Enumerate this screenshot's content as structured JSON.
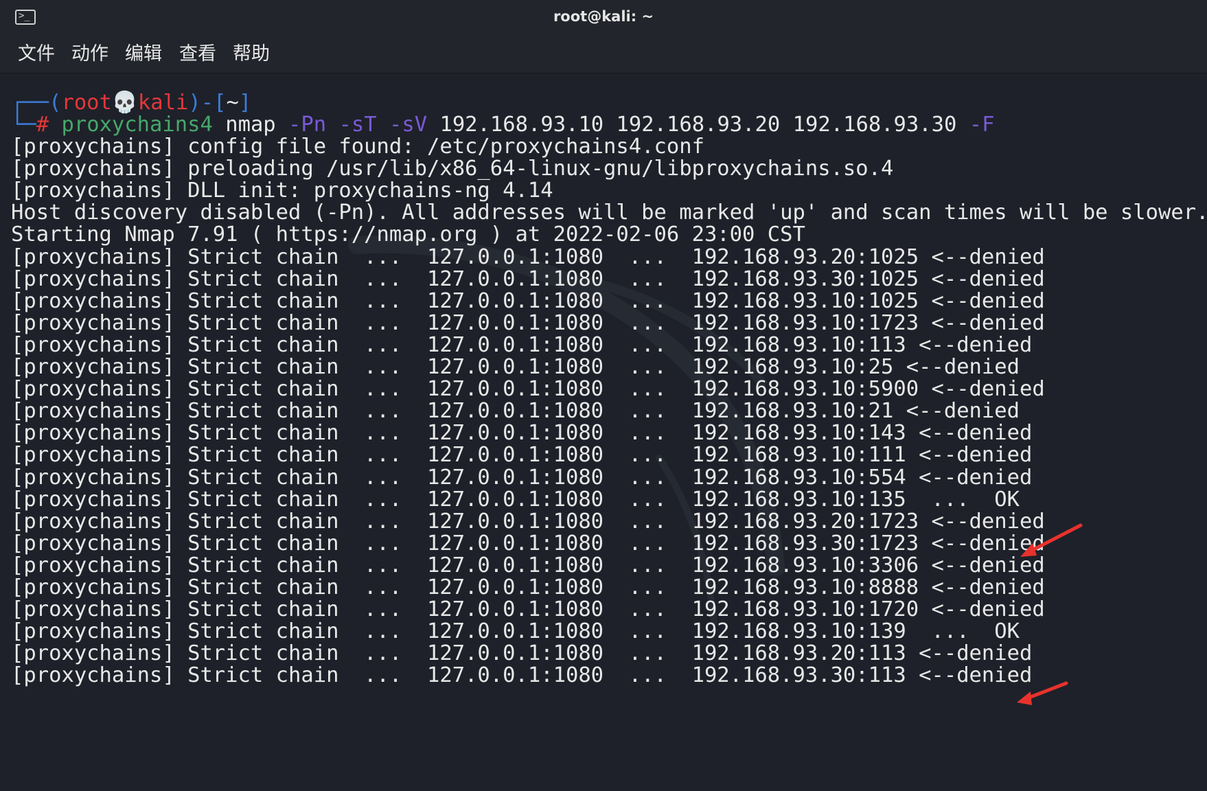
{
  "window": {
    "title": "root@kali: ~",
    "icon": "terminal-icon"
  },
  "menu": [
    "文件",
    "动作",
    "编辑",
    "查看",
    "帮助"
  ],
  "prompt": {
    "box_top": "┌──(",
    "user": "root",
    "skull": "💀",
    "host": "kali",
    "path_open": ")-[",
    "path": "~",
    "path_close": "]",
    "box_bottom": "└─",
    "hash": "#",
    "cmd": "proxychains4",
    "prog": "nmap",
    "args": [
      {
        "text": "-Pn",
        "kind": "flag"
      },
      {
        "text": "-sT",
        "kind": "flag"
      },
      {
        "text": "-sV",
        "kind": "flag"
      },
      {
        "text": "192.168.93.10",
        "kind": "arg"
      },
      {
        "text": "192.168.93.20",
        "kind": "arg"
      },
      {
        "text": "192.168.93.30",
        "kind": "arg"
      },
      {
        "text": "-F",
        "kind": "flag"
      }
    ]
  },
  "output": [
    "[proxychains] config file found: /etc/proxychains4.conf",
    "[proxychains] preloading /usr/lib/x86_64-linux-gnu/libproxychains.so.4",
    "[proxychains] DLL init: proxychains-ng 4.14",
    "Host discovery disabled (-Pn). All addresses will be marked 'up' and scan times will be slower.",
    "Starting Nmap 7.91 ( https://nmap.org ) at 2022-02-06 23:00 CST",
    "[proxychains] Strict chain  ...  127.0.0.1:1080  ...  192.168.93.20:1025 <--denied",
    "[proxychains] Strict chain  ...  127.0.0.1:1080  ...  192.168.93.30:1025 <--denied",
    "[proxychains] Strict chain  ...  127.0.0.1:1080  ...  192.168.93.10:1025 <--denied",
    "[proxychains] Strict chain  ...  127.0.0.1:1080  ...  192.168.93.10:1723 <--denied",
    "[proxychains] Strict chain  ...  127.0.0.1:1080  ...  192.168.93.10:113 <--denied",
    "[proxychains] Strict chain  ...  127.0.0.1:1080  ...  192.168.93.10:25 <--denied",
    "[proxychains] Strict chain  ...  127.0.0.1:1080  ...  192.168.93.10:5900 <--denied",
    "[proxychains] Strict chain  ...  127.0.0.1:1080  ...  192.168.93.10:21 <--denied",
    "[proxychains] Strict chain  ...  127.0.0.1:1080  ...  192.168.93.10:143 <--denied",
    "[proxychains] Strict chain  ...  127.0.0.1:1080  ...  192.168.93.10:111 <--denied",
    "[proxychains] Strict chain  ...  127.0.0.1:1080  ...  192.168.93.10:554 <--denied",
    "[proxychains] Strict chain  ...  127.0.0.1:1080  ...  192.168.93.10:135  ...  OK",
    "[proxychains] Strict chain  ...  127.0.0.1:1080  ...  192.168.93.20:1723 <--denied",
    "[proxychains] Strict chain  ...  127.0.0.1:1080  ...  192.168.93.30:1723 <--denied",
    "[proxychains] Strict chain  ...  127.0.0.1:1080  ...  192.168.93.10:3306 <--denied",
    "[proxychains] Strict chain  ...  127.0.0.1:1080  ...  192.168.93.10:8888 <--denied",
    "[proxychains] Strict chain  ...  127.0.0.1:1080  ...  192.168.93.10:1720 <--denied",
    "[proxychains] Strict chain  ...  127.0.0.1:1080  ...  192.168.93.10:139  ...  OK",
    "[proxychains] Strict chain  ...  127.0.0.1:1080  ...  192.168.93.20:113 <--denied",
    "[proxychains] Strict chain  ...  127.0.0.1:1080  ...  192.168.93.30:113 <--denied"
  ],
  "annotations": [
    {
      "name": "red-arrow-554",
      "color": "#e8322d"
    },
    {
      "name": "red-arrow-139",
      "color": "#e8322d"
    }
  ],
  "colors": {
    "background": "#1e2129",
    "prompt_box": "#3b7cd9",
    "user_host": "#e5373a",
    "command": "#46a86b",
    "flags": "#7a5ad6",
    "text": "#e8e8e8",
    "arrow": "#e8322d"
  }
}
